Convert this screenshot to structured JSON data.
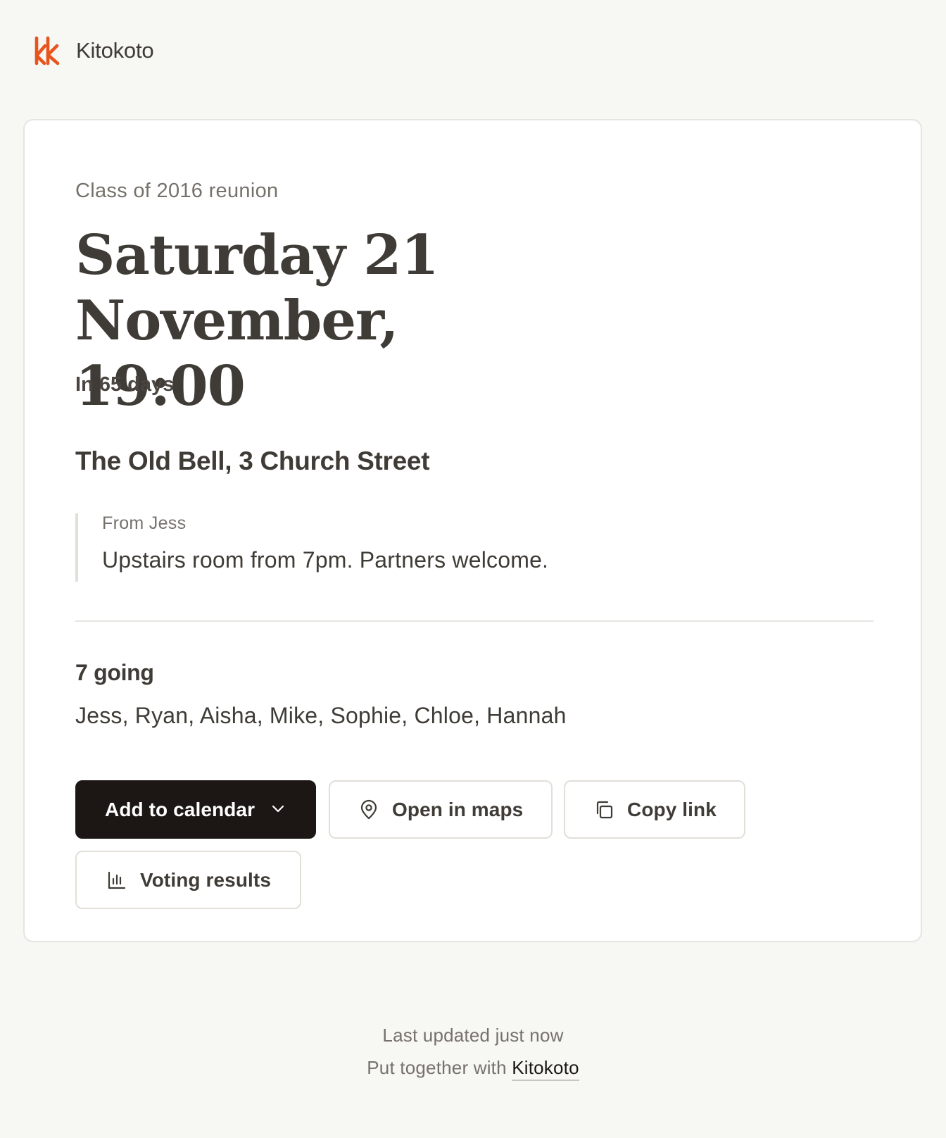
{
  "brand": {
    "name": "Kitokoto",
    "logo_icon": "kk-logo-icon",
    "accent_color": "#e8541c"
  },
  "event": {
    "name": "Class of 2016 reunion",
    "date_line_1": "Saturday 21 November,",
    "date_line_2": "19:00",
    "countdown": "In 65 days",
    "venue": "The Old Bell, 3 Church Street"
  },
  "note": {
    "author": "From Jess",
    "text": "Upstairs room from 7pm. Partners welcome."
  },
  "attendance": {
    "count_label": "7 going",
    "names": "Jess, Ryan, Aisha, Mike, Sophie, Chloe, Hannah"
  },
  "actions": {
    "add_to_calendar": {
      "label": "Add to calendar",
      "icon": "chevron-down-icon"
    },
    "open_in_maps": {
      "label": "Open in maps",
      "icon": "map-pin-icon"
    },
    "copy_link": {
      "label": "Copy link",
      "icon": "copy-icon"
    },
    "voting_results": {
      "label": "Voting results",
      "icon": "bar-chart-icon"
    }
  },
  "footer": {
    "updated": "Last updated just now",
    "credit_prefix": "Put together with",
    "credit_link": "Kitokoto"
  },
  "colors": {
    "background": "#f7f7f4",
    "card": "#ffffff",
    "text": "#3f3b36",
    "muted": "#76716b",
    "primary_button": "#1c1714"
  }
}
